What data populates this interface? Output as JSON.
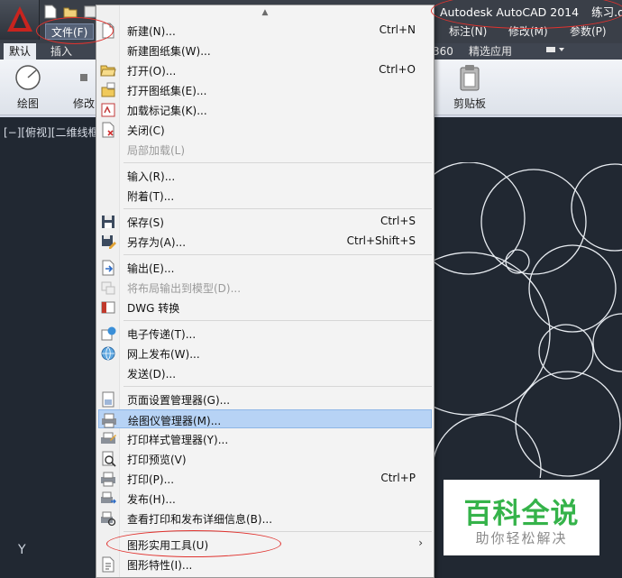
{
  "window": {
    "title_app": "Autodesk AutoCAD 2014",
    "title_file": "练习.dwg"
  },
  "menubar": {
    "file": "文件(F)",
    "annotate": "标注(N)",
    "modify": "修改(M)",
    "params": "参数(P)"
  },
  "ribbon": {
    "tabs": [
      "默认",
      "插入",
      "360",
      "精选应用"
    ],
    "big_buttons": {
      "draw": "绘图",
      "modify": "修改",
      "clipboard": "剪贴板"
    }
  },
  "viewport": {
    "label": "[−][俯视][二维线框]",
    "ucs_axis": "Y"
  },
  "file_menu": {
    "items": [
      {
        "label": "新建(N)...",
        "shortcut": "Ctrl+N",
        "icon": "new-file-icon",
        "disabled": false
      },
      {
        "label": "新建图纸集(W)...",
        "shortcut": "",
        "icon": "",
        "disabled": false
      },
      {
        "label": "打开(O)...",
        "shortcut": "Ctrl+O",
        "icon": "open-folder-icon",
        "disabled": false
      },
      {
        "label": "打开图纸集(E)...",
        "shortcut": "",
        "icon": "open-sheetset-icon",
        "disabled": false
      },
      {
        "label": "加载标记集(K)...",
        "shortcut": "",
        "icon": "markup-icon",
        "disabled": false
      },
      {
        "label": "关闭(C)",
        "shortcut": "",
        "icon": "close-file-icon",
        "disabled": false
      },
      {
        "label": "局部加载(L)",
        "shortcut": "",
        "icon": "",
        "disabled": true
      },
      {
        "label": "输入(R)...",
        "shortcut": "",
        "icon": "",
        "disabled": false
      },
      {
        "label": "附着(T)...",
        "shortcut": "",
        "icon": "",
        "disabled": false
      },
      {
        "label": "保存(S)",
        "shortcut": "Ctrl+S",
        "icon": "save-icon",
        "disabled": false
      },
      {
        "label": "另存为(A)...",
        "shortcut": "Ctrl+Shift+S",
        "icon": "save-as-icon",
        "disabled": false
      },
      {
        "label": "输出(E)...",
        "shortcut": "",
        "icon": "export-icon",
        "disabled": false
      },
      {
        "label": "将布局输出到模型(D)...",
        "shortcut": "",
        "icon": "layout-export-icon",
        "disabled": true
      },
      {
        "label": "DWG 转换",
        "shortcut": "",
        "icon": "dwg-convert-icon",
        "disabled": false
      },
      {
        "label": "电子传递(T)...",
        "shortcut": "",
        "icon": "etransmit-icon",
        "disabled": false
      },
      {
        "label": "网上发布(W)...",
        "shortcut": "",
        "icon": "publish-web-icon",
        "disabled": false
      },
      {
        "label": "发送(D)...",
        "shortcut": "",
        "icon": "",
        "disabled": false
      },
      {
        "label": "页面设置管理器(G)...",
        "shortcut": "",
        "icon": "page-setup-icon",
        "disabled": false
      },
      {
        "label": "绘图仪管理器(M)...",
        "shortcut": "",
        "icon": "plotter-manager-icon",
        "disabled": false
      },
      {
        "label": "打印样式管理器(Y)...",
        "shortcut": "",
        "icon": "plot-style-icon",
        "disabled": false
      },
      {
        "label": "打印预览(V)",
        "shortcut": "",
        "icon": "plot-preview-icon",
        "disabled": false
      },
      {
        "label": "打印(P)...",
        "shortcut": "Ctrl+P",
        "icon": "printer-icon",
        "disabled": false
      },
      {
        "label": "发布(H)...",
        "shortcut": "",
        "icon": "publish-icon",
        "disabled": false
      },
      {
        "label": "查看打印和发布详细信息(B)...",
        "shortcut": "",
        "icon": "plot-details-icon",
        "disabled": false
      },
      {
        "label": "图形实用工具(U)",
        "shortcut": "",
        "icon": "",
        "disabled": false,
        "submenu": true
      },
      {
        "label": "图形特性(I)...",
        "shortcut": "",
        "icon": "drawing-properties-icon",
        "disabled": false
      }
    ],
    "highlighted_label": "绘图仪管理器(M)..."
  },
  "watermark": {
    "brand": "百科全说",
    "slogan": "助你轻松解决"
  },
  "colors": {
    "annotation": "#e0332f",
    "highlight": "#b7d3f5",
    "drawing_bg": "#212832",
    "watermark_green": "#35b34a"
  }
}
